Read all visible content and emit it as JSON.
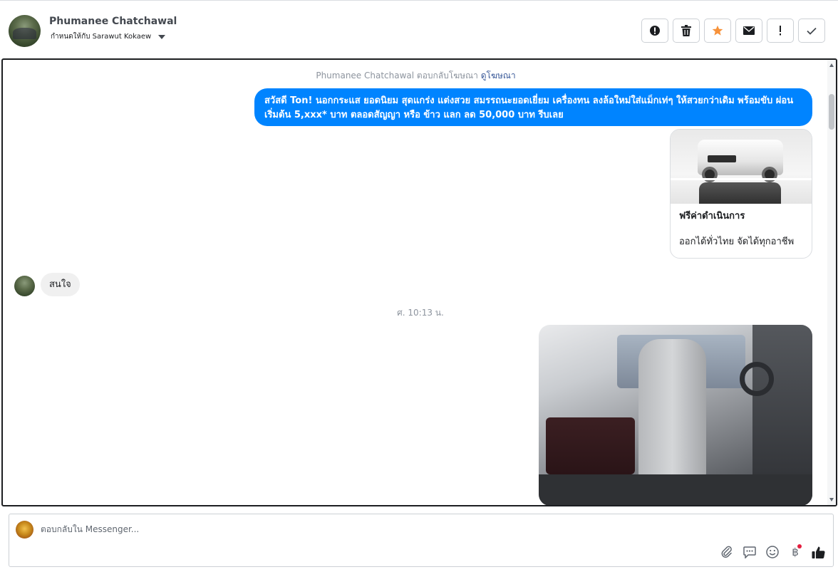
{
  "header": {
    "contact_name": "Phumanee Chatchawal",
    "assigned_label": "กำหนดให้กับ Sarawut Kokaew",
    "actions": [
      {
        "name": "spam-button",
        "icon": "alert-circle-icon",
        "color": "#1c1e21"
      },
      {
        "name": "delete-button",
        "icon": "trash-icon",
        "color": "#1c1e21"
      },
      {
        "name": "star-button",
        "icon": "star-icon",
        "color": "#f7923a"
      },
      {
        "name": "mark-unread-button",
        "icon": "envelope-icon",
        "color": "#1c1e21"
      },
      {
        "name": "follow-up-button",
        "icon": "exclamation-icon",
        "color": "#1c1e21"
      },
      {
        "name": "done-button",
        "icon": "check-icon",
        "color": "#1c1e21"
      }
    ]
  },
  "thread": {
    "ad_reply_text": "Phumanee Chatchawal ตอบกลับโฆษณา",
    "ad_reply_link": "ดูโฆษณา",
    "outgoing_message": "สวัสดี Ton! นอกกระแส ยอดนิยม สุดแกร่ง แต่งสวย สมรรถนะยอดเยี่ยม เครื่องทน ลงล้อใหม่ใส่แม็กเท่ๆ ให้สวยกว่าเดิม พร้อมขับ ผ่อนเริ่มต้น 5,xxx* บาท ตลอดสัญญา หรือ ข้าว แลก ลด 50,000 บาท รีบเลย",
    "card": {
      "title": "ฟรีค่าดำเนินการ",
      "subtitle": "ออกได้ทั่วไทย จัดได้ทุกอาชีพ"
    },
    "incoming_message": "สนใจ",
    "timestamp": "ศ. 10:13 น."
  },
  "composer": {
    "placeholder": "ตอบกลับใน Messenger...",
    "baht_symbol": "฿"
  },
  "colors": {
    "accent": "#0084ff",
    "star": "#f7923a",
    "notification_dot": "#e41e3f"
  }
}
